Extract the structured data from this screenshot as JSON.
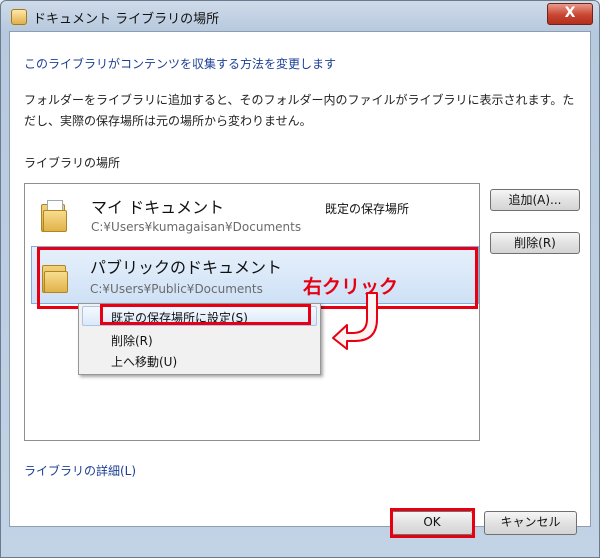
{
  "window": {
    "title": "ドキュメント ライブラリの場所",
    "close_label": "X"
  },
  "dialog": {
    "heading": "このライブラリがコンテンツを収集する方法を変更します",
    "description": "フォルダーをライブラリに追加すると、そのフォルダー内のファイルがライブラリに表示されます。ただし、実際の保存場所は元の場所から変わりません。",
    "locations_label": "ライブラリの場所",
    "details_link": "ライブラリの詳細(L)"
  },
  "locations": [
    {
      "name": "マイ ドキュメント",
      "path": "C:¥Users¥kumagaisan¥Documents",
      "note": "既定の保存場所"
    },
    {
      "name": "パブリックのドキュメント",
      "path": "C:¥Users¥Public¥Documents",
      "note": ""
    }
  ],
  "side_buttons": {
    "add": "追加(A)...",
    "remove": "削除(R)"
  },
  "context_menu": {
    "items": [
      "既定の保存場所に設定(S)",
      "削除(R)",
      "上へ移動(U)"
    ]
  },
  "annotation": {
    "text": "右クリック"
  },
  "footer": {
    "ok": "OK",
    "cancel": "キャンセル"
  },
  "colors": {
    "highlight_border": "#e60012",
    "link": "#1c3f94"
  }
}
